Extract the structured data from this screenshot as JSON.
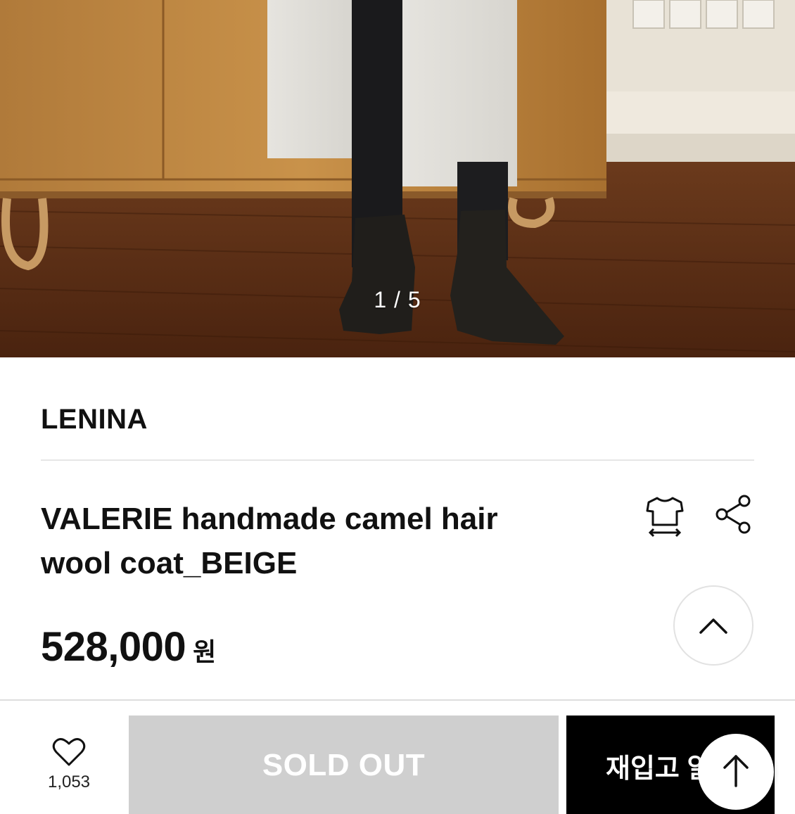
{
  "gallery": {
    "counter": "1 / 5"
  },
  "product": {
    "brand": "LENINA",
    "title_line1": "VALERIE handmade camel hair",
    "title_line2": "wool coat_BEIGE",
    "price": "528,000",
    "currency": "원"
  },
  "icons": {
    "size_guide": "tshirt-size-icon",
    "share": "share-icon",
    "scroll_top": "chevron-up-icon",
    "wishlist": "heart-icon",
    "float_top": "arrow-up-icon"
  },
  "bottom_bar": {
    "wish_count": "1,053",
    "soldout_label": "SOLD OUT",
    "restock_label": "재입고 알림"
  },
  "colors": {
    "accent": "#000000",
    "disabled": "#cfcfcf"
  }
}
